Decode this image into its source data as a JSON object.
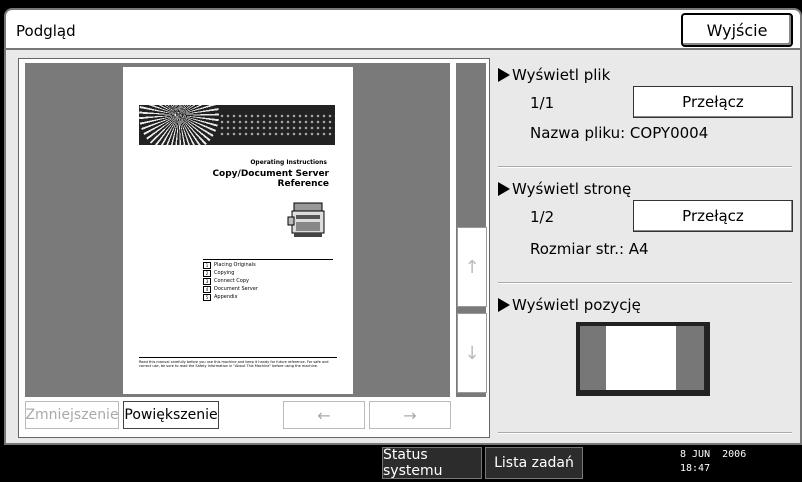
{
  "window": {
    "title": "Podgląd",
    "exit_label": "Wyjście"
  },
  "preview": {
    "document": {
      "sub_heading": "Operating Instructions",
      "title": "Copy/Document Server Reference",
      "toc": [
        {
          "num": "1",
          "label": "Placing Originals"
        },
        {
          "num": "2",
          "label": "Copying"
        },
        {
          "num": "3",
          "label": "Connect Copy"
        },
        {
          "num": "4",
          "label": "Document Server"
        },
        {
          "num": "5",
          "label": "Appendix"
        }
      ],
      "footer": "Read this manual carefully before you use this machine and keep it handy for future reference. For safe and correct use, be sure to read the Safety Information in \"About This Machine\" before using the machine."
    },
    "scroll_up_icon": "↑",
    "scroll_down_icon": "↓",
    "zoom_out_label": "Zmniejszenie",
    "zoom_in_label": "Powiększenie",
    "prev_icon": "←",
    "next_icon": "→"
  },
  "file_section": {
    "heading": "Wyświetl plik",
    "counter": "1/1",
    "switch_label": "Przełącz",
    "filename_text": "Nazwa pliku: COPY0004"
  },
  "page_section": {
    "heading": "Wyświetl stronę",
    "counter": "1/2",
    "switch_label": "Przełącz",
    "size_text": "Rozmiar str.: A4"
  },
  "position_section": {
    "heading": "Wyświetl pozycję"
  },
  "status_bar": {
    "system_status_label": "Status systemu",
    "job_list_label": "Lista zadań",
    "date": "8 JUN  2006",
    "time": "18:47"
  }
}
